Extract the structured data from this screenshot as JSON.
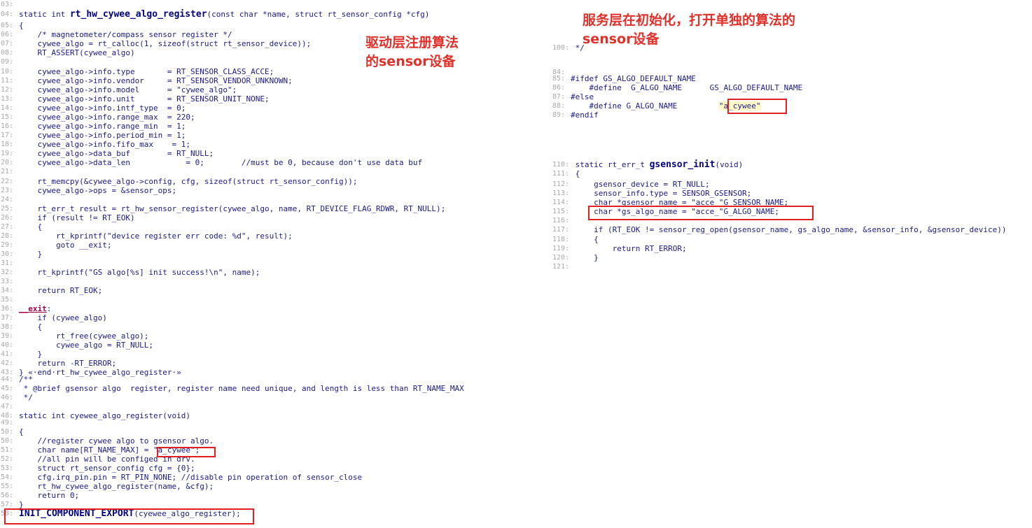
{
  "annotations": {
    "left": "驱动层注册算法\n的sensor设备",
    "right": "服务层在初始化，打开单独的算法的\nsensor设备"
  },
  "left_code": {
    "lines": [
      {
        "n": "03:",
        "t": ""
      },
      {
        "n": "04:",
        "t": "static int rt_hw_cywee_algo_register(const char *name, struct rt_sensor_config *cfg)"
      },
      {
        "n": "05:",
        "t": "{"
      },
      {
        "n": "06:",
        "t": "    /* magnetometer/compass sensor register */"
      },
      {
        "n": "07:",
        "t": "    cywee_algo = rt_calloc(1, sizeof(struct rt_sensor_device));"
      },
      {
        "n": "08:",
        "t": "    RT_ASSERT(cywee_algo)"
      },
      {
        "n": "09:",
        "t": ""
      },
      {
        "n": "10:",
        "t": "    cywee_algo->info.type       = RT_SENSOR_CLASS_ACCE;"
      },
      {
        "n": "11:",
        "t": "    cywee_algo->info.vendor     = RT_SENSOR_VENDOR_UNKNOWN;"
      },
      {
        "n": "12:",
        "t": "    cywee_algo->info.model      = \"cywee_algo\";"
      },
      {
        "n": "13:",
        "t": "    cywee_algo->info.unit       = RT_SENSOR_UNIT_NONE;"
      },
      {
        "n": "14:",
        "t": "    cywee_algo->info.intf_type  = 0;"
      },
      {
        "n": "15:",
        "t": "    cywee_algo->info.range_max  = 220;"
      },
      {
        "n": "16:",
        "t": "    cywee_algo->info.range_min  = 1;"
      },
      {
        "n": "17:",
        "t": "    cywee_algo->info.period_min = 1;"
      },
      {
        "n": "18:",
        "t": "    cywee_algo->info.fifo_max    = 1;"
      },
      {
        "n": "19:",
        "t": "    cywee_algo->data_buf        = RT_NULL;"
      },
      {
        "n": "20:",
        "t": "    cywee_algo->data_len            = 0;        //must be 0, because don't use data buf"
      },
      {
        "n": "21:",
        "t": ""
      },
      {
        "n": "22:",
        "t": "    rt_memcpy(&cywee_algo->config, cfg, sizeof(struct rt_sensor_config));"
      },
      {
        "n": "23:",
        "t": "    cywee_algo->ops = &sensor_ops;"
      },
      {
        "n": "24:",
        "t": ""
      },
      {
        "n": "25:",
        "t": "    rt_err_t result = rt_hw_sensor_register(cywee_algo, name, RT_DEVICE_FLAG_RDWR, RT_NULL);"
      },
      {
        "n": "26:",
        "t": "    if (result != RT_EOK)"
      },
      {
        "n": "27:",
        "t": "    {"
      },
      {
        "n": "28:",
        "t": "        rt_kprintf(\"device register err code: %d\", result);"
      },
      {
        "n": "29:",
        "t": "        goto __exit;"
      },
      {
        "n": "30:",
        "t": "    }"
      },
      {
        "n": "31:",
        "t": ""
      },
      {
        "n": "32:",
        "t": "    rt_kprintf(\"GS algo[%s] init success!\\n\", name);"
      },
      {
        "n": "33:",
        "t": ""
      },
      {
        "n": "34:",
        "t": "    return RT_EOK;"
      },
      {
        "n": "35:",
        "t": ""
      },
      {
        "n": "36:",
        "t": "__exit:"
      },
      {
        "n": "37:",
        "t": "    if (cywee_algo)"
      },
      {
        "n": "38:",
        "t": "    {"
      },
      {
        "n": "39:",
        "t": "        rt_free(cywee_algo);"
      },
      {
        "n": "40:",
        "t": "        cywee_algo = RT_NULL;"
      },
      {
        "n": "41:",
        "t": "    }"
      },
      {
        "n": "42:",
        "t": "    return -RT_ERROR;"
      },
      {
        "n": "43:",
        "t": "} «·end·rt_hw_cywee_algo_register·»"
      },
      {
        "n": "44:",
        "t": "/**"
      },
      {
        "n": "45:",
        "t": " * @brief gsensor algo  register, register name need unique, and length is less than RT_NAME_MAX"
      },
      {
        "n": "46:",
        "t": " */"
      },
      {
        "n": "47:",
        "t": ""
      },
      {
        "n": "48:",
        "t": "static int cyewee_algo_register(void)"
      },
      {
        "n": "49:",
        "t": ""
      },
      {
        "n": "50:",
        "t": "{"
      },
      {
        "n": "50:",
        "t": "    //register cywee algo to gsensor algo."
      },
      {
        "n": "51:",
        "t": "    char name[RT_NAME_MAX] = \"a_cywee\";"
      },
      {
        "n": "52:",
        "t": "    //all pin will be configed in drv."
      },
      {
        "n": "53:",
        "t": "    struct rt_sensor_config cfg = {0};"
      },
      {
        "n": "54:",
        "t": "    cfg.irq_pin.pin = RT_PIN_NONE; //disable pin operation of sensor_close"
      },
      {
        "n": "55:",
        "t": "    rt_hw_cywee_algo_register(name, &cfg);"
      },
      {
        "n": "56:",
        "t": "    return 0;"
      },
      {
        "n": "57:",
        "t": "}"
      },
      {
        "n": "58:",
        "t": "INIT_COMPONENT_EXPORT(cyewee_algo_register);"
      }
    ]
  },
  "right_top": {
    "lines": [
      {
        "n": "100:",
        "t": " */"
      },
      {
        "n": "84:",
        "t": ""
      },
      {
        "n": "85:",
        "t": "#ifdef GS_ALGO_DEFAULT_NAME"
      },
      {
        "n": "86:",
        "t": "    #define  G_ALGO_NAME      GS_ALGO_DEFAULT_NAME"
      },
      {
        "n": "87:",
        "t": "#else"
      },
      {
        "n": "88:",
        "t": "    #define G_ALGO_NAME         \"a_cywee\""
      },
      {
        "n": "89:",
        "t": "#endif"
      }
    ]
  },
  "right_bottom": {
    "lines": [
      {
        "n": "110:",
        "t": " static rt_err_t gsensor_init(void)"
      },
      {
        "n": "111:",
        "t": " {"
      },
      {
        "n": "112:",
        "t": "     gsensor_device = RT_NULL;"
      },
      {
        "n": "113:",
        "t": "     sensor_info.type = SENSOR_GSENSOR;"
      },
      {
        "n": "114:",
        "t": "     char *gsensor_name = \"acce_\"G_SENSOR_NAME;"
      },
      {
        "n": "115:",
        "t": "     char *gs_algo_name = \"acce_\"G_ALGO_NAME;"
      },
      {
        "n": "116:",
        "t": ""
      },
      {
        "n": "117:",
        "t": "     if (RT_EOK != sensor_reg_open(gsensor_name, gs_algo_name, &sensor_info, &gsensor_device))"
      },
      {
        "n": "118:",
        "t": "     {"
      },
      {
        "n": "119:",
        "t": "         return RT_ERROR;"
      },
      {
        "n": "120:",
        "t": "     }"
      },
      {
        "n": "121:",
        "t": ""
      }
    ]
  }
}
